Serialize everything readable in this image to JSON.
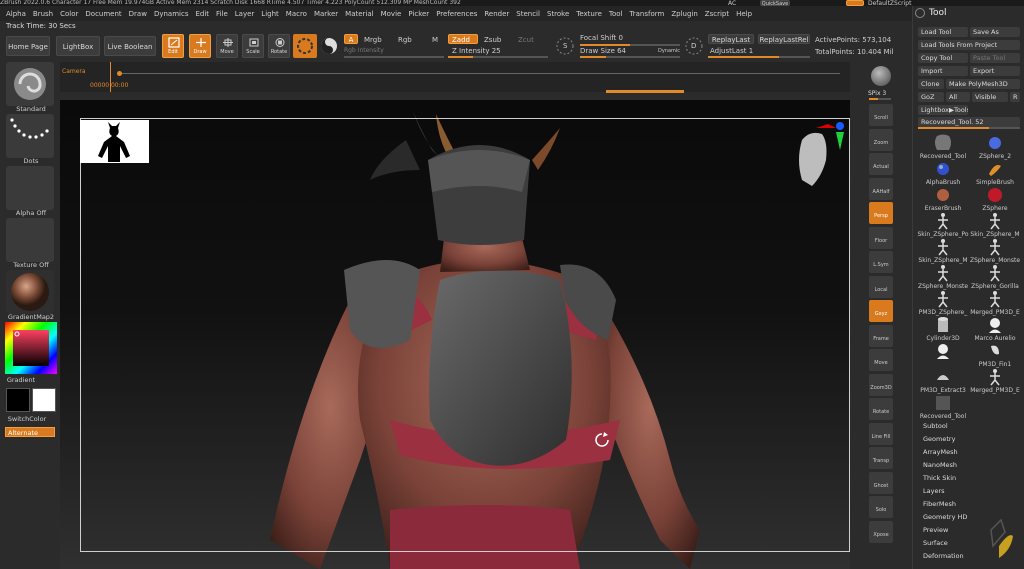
{
  "titlebar": {
    "text": "ZBrush 2022.0.6   Character 17   Free Mem 19.974GB   Active Mem 2314   Scratch Disk 1668   RTime 4.507   Timer 4.223   PolyCount 512.309 MP   MeshCount 392"
  },
  "menubar": {
    "items": [
      "Alpha",
      "Brush",
      "Color",
      "Document",
      "Draw",
      "Dynamics",
      "Edit",
      "File",
      "Layer",
      "Light",
      "Macro",
      "Marker",
      "Material",
      "Movie",
      "Picker",
      "Preferences",
      "Render",
      "Stencil",
      "Stroke",
      "Texture",
      "Tool",
      "Transform",
      "Zplugin",
      "Zscript",
      "Help"
    ]
  },
  "track_time": "Track Time: 30 Secs",
  "top_right": {
    "ac": "AC",
    "quicksave": "QuickSave",
    "default_script": "DefaultZScript"
  },
  "toolbar": {
    "home_page": "Home Page",
    "lightbox": "LightBox",
    "live_boolean": "Live Boolean",
    "edit": "Edit",
    "draw": "Draw",
    "move": "Move",
    "scale": "Scale",
    "rotate": "Rotate",
    "a": "A",
    "mrgb": "Mrgb",
    "rgb": "Rgb",
    "m": "M",
    "rgb_intensity": "Rgb Intensity",
    "zadd": "Zadd",
    "zsub": "Zsub",
    "zcut": "Zcut",
    "z_intensity": "Z Intensity 25",
    "focal_shift": "Focal Shift 0",
    "draw_size": "Draw Size 64",
    "dynamic": "Dynamic",
    "replay_last": "ReplayLast",
    "replay_last_rel": "ReplayLastRel",
    "adjust_last": "AdjustLast 1",
    "active_points": "ActivePoints: 573,104",
    "total_points": "TotalPoints: 10.404 Mil",
    "s_label": "S",
    "d_label": "D"
  },
  "timeline": {
    "camera": "Camera",
    "timecode": "00000 00:00"
  },
  "left_panel": {
    "standard": "Standard",
    "dots": "Dots",
    "alpha_off": "Alpha Off",
    "texture_off": "Texture Off",
    "material": "GradientMap2",
    "gradient": "Gradient",
    "switch_color": "SwitchColor",
    "alternate": "Alternate"
  },
  "right_strip": {
    "spix": "SPix 3",
    "buttons": [
      "Scroll",
      "Zoom",
      "Actual",
      "AAHalf",
      "Persp",
      "Floor",
      "L.Sym",
      "Local",
      "Gxyz",
      "Frame",
      "Move",
      "Zoom3D",
      "Rotate",
      "Line Fill",
      "Transp",
      "Ghost",
      "Solo",
      "Xpose"
    ]
  },
  "tool_panel": {
    "title": "Tool",
    "load_tool": "Load Tool",
    "save_as": "Save As",
    "load_from_project": "Load Tools From Project",
    "copy_tool": "Copy Tool",
    "paste_tool": "Paste Tool",
    "import": "Import",
    "export": "Export",
    "clone": "Clone",
    "make_polymesh": "Make PolyMesh3D",
    "goz": "GoZ",
    "all": "All",
    "visible": "Visible",
    "r": "R",
    "lightbox_tools": "Lightbox▶Tools",
    "recovered_tool": "Recovered_Tool. 52",
    "tools": [
      {
        "label": "Recovered_Tool",
        "icon": "head-icon"
      },
      {
        "label": "ZSphere_2",
        "icon": "zsphere-icon"
      },
      {
        "label": "AlphaBrush",
        "icon": "alpha-brush-icon"
      },
      {
        "label": "SimpleBrush",
        "icon": "simple-brush-icon"
      },
      {
        "label": "EraserBrush",
        "icon": "eraser-brush-icon"
      },
      {
        "label": "ZSphere",
        "icon": "zsphere-red-icon"
      },
      {
        "label": "Skin_ZSphere_Po",
        "icon": "figure-icon"
      },
      {
        "label": "Skin_ZSphere_M",
        "icon": "figure-icon"
      },
      {
        "label": "Skin_ZSphere_M",
        "icon": "figure-icon"
      },
      {
        "label": "ZSphere_Monste",
        "icon": "figure-icon"
      },
      {
        "label": "ZSphere_Monste",
        "icon": "figure-icon"
      },
      {
        "label": "ZSphere_Gorilla",
        "icon": "figure-icon"
      },
      {
        "label": "PM3D_ZSphere_",
        "icon": "figure-icon"
      },
      {
        "label": "Merged_PM3D_E",
        "icon": "figure-icon"
      },
      {
        "label": "Cylinder3D",
        "icon": "cylinder-icon"
      },
      {
        "label": "Marco Aurelio",
        "icon": "bust-icon"
      },
      {
        "label": "",
        "icon": "bust-icon"
      },
      {
        "label": "PM3D_Fin1",
        "icon": "fin-icon"
      },
      {
        "label": "PM3D_Extract3",
        "icon": "extract-icon"
      },
      {
        "label": "Merged_PM3D_E",
        "icon": "figure-icon"
      },
      {
        "label": "Recovered_Tool",
        "icon": "armor-icon"
      }
    ],
    "subpalettes": [
      "Subtool",
      "Geometry",
      "ArrayMesh",
      "NanoMesh",
      "Thick Skin",
      "Layers",
      "FiberMesh",
      "Geometry HD",
      "Preview",
      "Surface",
      "Deformation"
    ]
  },
  "colors": {
    "accent": "#d97a1e",
    "panel": "#2b2b2b",
    "button": "#3c3c3c"
  }
}
